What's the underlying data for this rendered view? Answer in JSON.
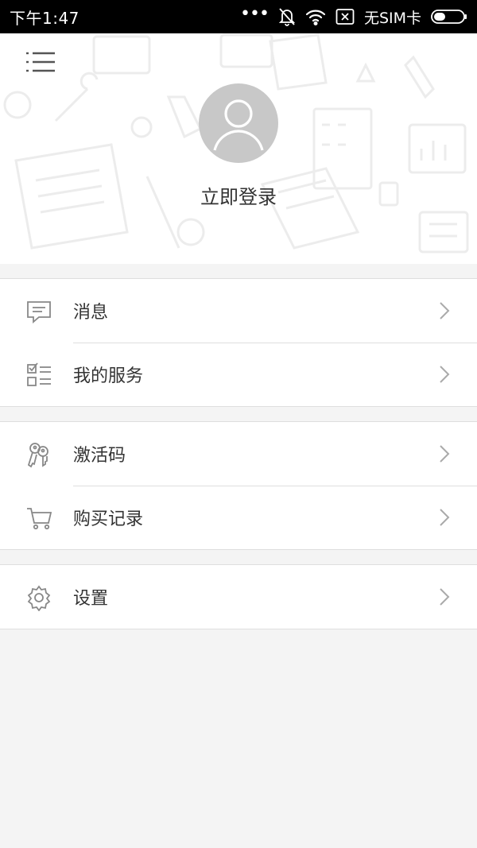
{
  "status_bar": {
    "time": "下午1:47",
    "dots": "•••",
    "carrier": "无SIM卡",
    "icons": [
      "mute-bell-icon",
      "wifi-icon",
      "no-sim-icon",
      "battery-icon"
    ]
  },
  "header": {
    "menu_icon": "menu-list-icon",
    "avatar_icon": "default-avatar-icon",
    "login_label": "立即登录"
  },
  "menu": {
    "group1": [
      {
        "label": "消息",
        "icon": "message-icon"
      },
      {
        "label": "我的服务",
        "icon": "checklist-icon"
      }
    ],
    "group2": [
      {
        "label": "激活码",
        "icon": "keys-icon"
      },
      {
        "label": "购买记录",
        "icon": "cart-icon"
      }
    ],
    "group3": [
      {
        "label": "设置",
        "icon": "gear-icon"
      }
    ]
  },
  "colors": {
    "status_bar_bg": "#000000",
    "page_bg": "#f4f4f4",
    "avatar_bg": "#c8c8c8",
    "icon_gray": "#888888",
    "text": "#333333"
  }
}
